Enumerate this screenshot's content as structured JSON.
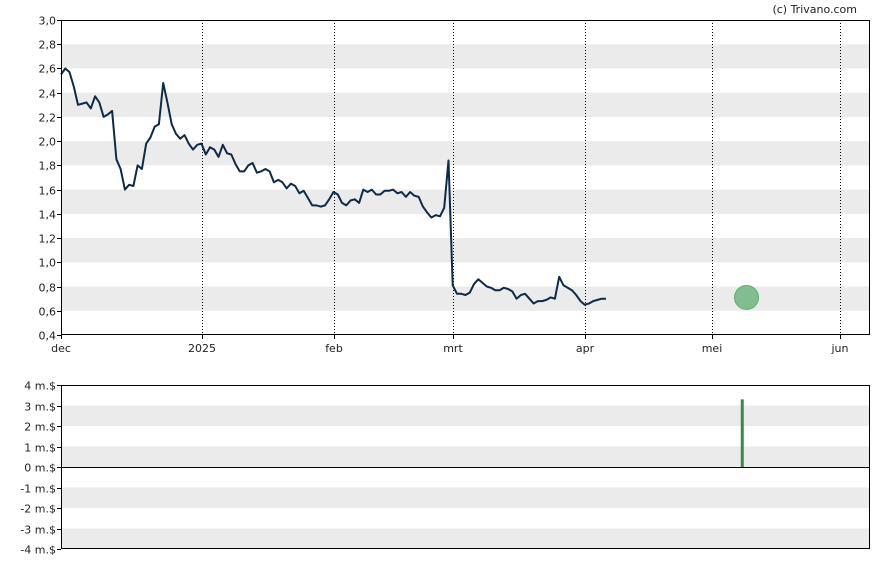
{
  "credit": "(c) Trivano.com",
  "colors": {
    "background": "#ffffff",
    "band": "#ebebeb",
    "price_line": "#0e2a47",
    "marker_fill": "#5fae6e",
    "volume_bar": "#3a8a4f",
    "frame": "#000000",
    "month_grid": "#000000"
  },
  "chart_data": [
    {
      "type": "line",
      "title": "",
      "xlabel": "",
      "ylabel": "",
      "ylim": [
        0.4,
        3.0
      ],
      "y_ticks": [
        "3,0",
        "2,8",
        "2,6",
        "2,4",
        "2,2",
        "2,0",
        "1,8",
        "1,6",
        "1,4",
        "1,2",
        "1,0",
        "0,8",
        "0,6",
        "0,4"
      ],
      "x_ticks": [
        "dec",
        "2025",
        "feb",
        "mrt",
        "apr",
        "mei",
        "jun"
      ],
      "x_tick_days": [
        0,
        33,
        64,
        92,
        123,
        153,
        183
      ],
      "x_range_days": [
        0,
        190
      ],
      "grid": "alternating horizontal bands, dotted vertical month lines",
      "x_days": [
        0,
        1,
        2,
        3,
        4,
        5,
        6,
        7,
        8,
        9,
        10,
        11,
        12,
        13,
        14,
        15,
        16,
        17,
        18,
        19,
        20,
        21,
        22,
        23,
        24,
        25,
        26,
        27,
        28,
        29,
        30,
        31,
        32,
        33,
        34,
        35,
        36,
        37,
        38,
        39,
        40,
        41,
        42,
        43,
        44,
        45,
        46,
        47,
        48,
        49,
        50,
        51,
        52,
        53,
        54,
        55,
        56,
        57,
        58,
        59,
        60,
        61,
        62,
        63,
        64,
        65,
        66,
        67,
        68,
        69,
        70,
        71,
        72,
        73,
        74,
        75,
        76,
        77,
        78,
        79,
        80,
        81,
        82,
        83,
        84,
        85,
        86,
        87,
        88,
        89,
        90,
        91,
        92,
        93,
        94,
        95,
        96,
        97,
        98,
        99,
        100,
        101,
        102,
        103,
        104,
        105,
        106,
        107,
        108,
        109,
        110,
        111,
        112,
        113,
        114,
        115,
        116,
        117,
        118,
        119,
        120,
        121,
        122,
        123,
        124,
        125,
        126,
        127,
        128,
        129,
        130,
        131,
        132,
        133,
        134,
        135,
        136,
        137,
        138,
        139,
        140,
        141,
        142,
        143,
        144,
        145,
        146,
        147,
        148,
        149,
        150,
        151,
        152,
        153,
        154,
        155,
        156,
        157,
        158,
        159,
        160,
        161,
        162,
        163,
        164,
        165,
        166,
        167,
        168,
        169,
        170,
        171,
        172,
        173,
        174,
        175,
        176,
        177,
        178,
        179,
        180,
        181,
        182,
        183,
        184,
        185,
        186,
        187,
        188,
        189,
        190
      ],
      "series": [
        {
          "values": [
            2.55,
            2.6,
            2.57,
            2.45,
            2.3,
            2.31,
            2.32,
            2.27,
            2.37,
            2.32,
            2.2,
            2.22,
            2.25,
            1.85,
            1.77,
            1.6,
            1.64,
            1.63,
            1.8,
            1.77,
            1.98,
            2.03,
            2.12,
            2.14,
            2.48,
            2.32,
            2.14,
            2.06,
            2.02,
            2.05,
            1.98,
            1.93,
            1.97,
            1.98,
            1.89,
            1.95,
            1.93,
            1.87,
            1.97,
            1.9,
            1.89,
            1.81,
            1.75,
            1.75,
            1.8,
            1.82,
            1.74,
            1.75,
            1.77,
            1.75,
            1.66,
            1.68,
            1.66,
            1.61,
            1.65,
            1.63,
            1.57,
            1.59,
            1.53,
            1.47,
            1.47,
            1.46,
            1.47,
            1.52,
            1.58,
            1.56,
            1.49,
            1.47,
            1.51,
            1.52,
            1.49,
            1.6,
            1.58,
            1.6,
            1.56,
            1.56,
            1.59,
            1.59,
            1.6,
            1.57,
            1.58,
            1.54,
            1.58,
            1.55,
            1.54,
            1.46,
            1.41,
            1.37,
            1.39,
            1.38,
            1.45,
            1.84,
            0.81,
            0.74,
            0.74,
            0.73,
            0.75,
            0.82,
            0.86,
            0.83,
            0.8,
            0.79,
            0.77,
            0.77,
            0.79,
            0.78,
            0.76,
            0.7,
            0.73,
            0.74,
            0.7,
            0.66,
            0.68,
            0.68,
            0.69,
            0.71,
            0.7,
            0.88,
            0.81,
            0.79,
            0.77,
            0.73,
            0.68,
            0.65,
            0.66,
            0.68,
            0.69,
            0.7,
            0.7
          ]
        }
      ],
      "marker": {
        "x_day": 161,
        "value": 0.71
      }
    },
    {
      "type": "bar",
      "title": "",
      "xlabel": "",
      "ylabel": "",
      "ylim": [
        -4,
        4
      ],
      "y_ticks": [
        "4 m.$",
        "3 m.$",
        "2 m.$",
        "1 m.$",
        "0 m.$",
        "-1 m.$",
        "-2 m.$",
        "-3 m.$",
        "-4 m.$"
      ],
      "x_range_days": [
        0,
        190
      ],
      "grid": "alternating horizontal bands",
      "bars": [
        {
          "x_day": 160,
          "value": 3.3
        }
      ]
    }
  ]
}
